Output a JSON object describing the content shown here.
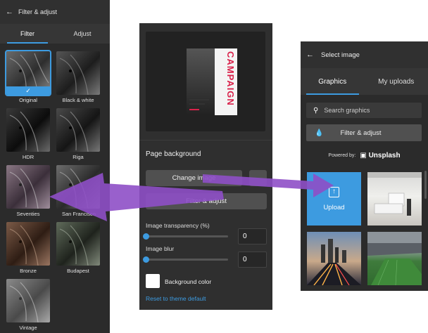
{
  "filter_panel": {
    "back_icon": "arrow-left-icon",
    "title": "Filter & adjust",
    "tabs": [
      "Filter",
      "Adjust"
    ],
    "active_tab": "Filter",
    "filters": [
      {
        "label": "Original",
        "selected": true
      },
      {
        "label": "Black & white",
        "selected": false
      },
      {
        "label": "HDR",
        "selected": false
      },
      {
        "label": "Riga",
        "selected": false
      },
      {
        "label": "Seventies",
        "selected": false
      },
      {
        "label": "San Francisco",
        "selected": false
      },
      {
        "label": "Bronze",
        "selected": false
      },
      {
        "label": "Budapest",
        "selected": false
      },
      {
        "label": "Vintage",
        "selected": false
      }
    ],
    "check_icon": "checkmark-icon"
  },
  "page_panel": {
    "poster_title": "CAMPAIGN",
    "section_title": "Page background",
    "change_image_label": "Change image",
    "filter_adjust_label": "Filter & adjust",
    "transparency_label": "Image transparency (%)",
    "transparency_value": "0",
    "blur_label": "Image blur",
    "blur_value": "0",
    "background_color_label": "Background color",
    "background_color": "#ffffff",
    "reset_link": "Reset to theme default"
  },
  "image_panel": {
    "back_icon": "arrow-left-icon",
    "title": "Select image",
    "tabs": [
      "Graphics",
      "My uploads"
    ],
    "active_tab": "Graphics",
    "search_icon": "search-icon",
    "search_placeholder": "Search graphics",
    "filter_button_icon": "droplet-icon",
    "filter_button_label": "Filter & adjust",
    "powered_by": "Powered by:",
    "provider": "Unsplash",
    "upload_icon": "upload-icon",
    "upload_label": "Upload"
  },
  "colors": {
    "accent": "#3d9be0",
    "panel_bg": "#2b2b2b",
    "arrow": "#8e4fc6",
    "poster_red": "#d9224b"
  }
}
